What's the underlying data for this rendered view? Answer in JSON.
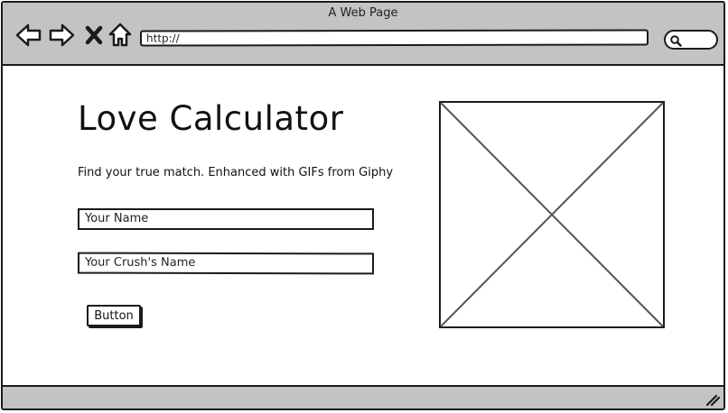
{
  "window": {
    "title": "A Web Page"
  },
  "toolbar": {
    "icons": [
      "back-arrow-icon",
      "forward-arrow-icon",
      "close-x-icon",
      "home-icon",
      "search-icon"
    ],
    "url": "http://"
  },
  "page": {
    "title": "Love Calculator",
    "tagline": "Find your true match. Enhanced with GIFs from Giphy",
    "name_field": "Your Name",
    "crush_field": "Your Crush's Name",
    "button_label": "Button"
  },
  "colors": {
    "chrome": "#c3c3c3",
    "ink": "#1b1b1b",
    "background": "#ffffff"
  }
}
